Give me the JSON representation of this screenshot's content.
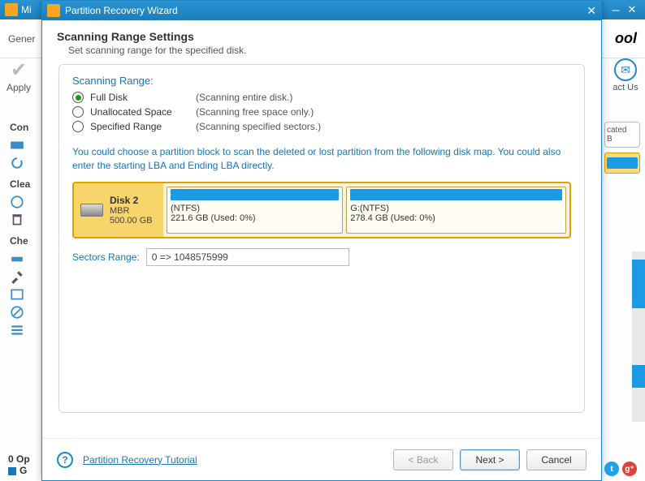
{
  "bg": {
    "app_title": "Mi",
    "general_label": "Gener",
    "logo_text": "ool",
    "apply_label": "Apply",
    "side_labels": {
      "convert": "Con",
      "clean": "Clea",
      "check": "Che"
    },
    "footer_ops": "0 Op",
    "footer_g": "G",
    "contact_label": "act Us",
    "right_panel": {
      "cated": "cated",
      "b": "B"
    }
  },
  "dialog": {
    "title": "Partition Recovery Wizard",
    "header_title": "Scanning Range Settings",
    "header_sub": "Set scanning range for the specified disk.",
    "group_legend": "Scanning Range:",
    "radios": [
      {
        "name": "Full Disk",
        "desc": "(Scanning entire disk.)",
        "selected": true
      },
      {
        "name": "Unallocated Space",
        "desc": "(Scanning free space only.)",
        "selected": false
      },
      {
        "name": "Specified Range",
        "desc": "(Scanning specified sectors.)",
        "selected": false
      }
    ],
    "instructions": "You could choose a partition block to scan the deleted or lost partition from the following disk map. You could also enter the starting LBA and Ending LBA directly.",
    "disk": {
      "name": "Disk 2",
      "scheme": "MBR",
      "size": "500.00 GB",
      "parts": [
        {
          "label": "(NTFS)",
          "size": "221.6 GB (Used: 0%)"
        },
        {
          "label": "G:(NTFS)",
          "size": "278.4 GB (Used: 0%)"
        }
      ]
    },
    "sectors_label": "Sectors Range:",
    "sectors_value": "0 => 1048575999",
    "help_link": "Partition Recovery Tutorial",
    "buttons": {
      "back": "< Back",
      "next": "Next >",
      "cancel": "Cancel"
    }
  }
}
